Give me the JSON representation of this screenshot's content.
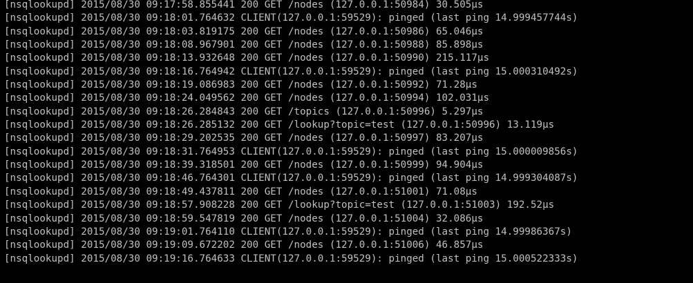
{
  "terminal": {
    "colors": {
      "background": "#000000",
      "foreground": "#c0c0c0"
    },
    "lines": [
      "[nsqlookupd] 2015/08/30 09:17:58.855441 200 GET /nodes (127.0.0.1:50984) 30.505µs",
      "[nsqlookupd] 2015/08/30 09:18:01.764632 CLIENT(127.0.0.1:59529): pinged (last ping 14.999457744s)",
      "[nsqlookupd] 2015/08/30 09:18:03.819175 200 GET /nodes (127.0.0.1:50986) 65.046µs",
      "[nsqlookupd] 2015/08/30 09:18:08.967901 200 GET /nodes (127.0.0.1:50988) 85.898µs",
      "[nsqlookupd] 2015/08/30 09:18:13.932648 200 GET /nodes (127.0.0.1:50990) 215.117µs",
      "[nsqlookupd] 2015/08/30 09:18:16.764942 CLIENT(127.0.0.1:59529): pinged (last ping 15.000310492s)",
      "[nsqlookupd] 2015/08/30 09:18:19.086983 200 GET /nodes (127.0.0.1:50992) 71.28µs",
      "[nsqlookupd] 2015/08/30 09:18:24.049562 200 GET /nodes (127.0.0.1:50994) 102.031µs",
      "[nsqlookupd] 2015/08/30 09:18:26.284843 200 GET /topics (127.0.0.1:50996) 5.297µs",
      "[nsqlookupd] 2015/08/30 09:18:26.285132 200 GET /lookup?topic=test (127.0.0.1:50996) 13.119µs",
      "[nsqlookupd] 2015/08/30 09:18:29.202535 200 GET /nodes (127.0.0.1:50997) 83.207µs",
      "[nsqlookupd] 2015/08/30 09:18:31.764953 CLIENT(127.0.0.1:59529): pinged (last ping 15.000009856s)",
      "[nsqlookupd] 2015/08/30 09:18:39.318501 200 GET /nodes (127.0.0.1:50999) 94.904µs",
      "[nsqlookupd] 2015/08/30 09:18:46.764301 CLIENT(127.0.0.1:59529): pinged (last ping 14.999304087s)",
      "[nsqlookupd] 2015/08/30 09:18:49.437811 200 GET /nodes (127.0.0.1:51001) 71.08µs",
      "[nsqlookupd] 2015/08/30 09:18:57.908228 200 GET /lookup?topic=test (127.0.0.1:51003) 192.52µs",
      "[nsqlookupd] 2015/08/30 09:18:59.547819 200 GET /nodes (127.0.0.1:51004) 32.086µs",
      "[nsqlookupd] 2015/08/30 09:19:01.764110 CLIENT(127.0.0.1:59529): pinged (last ping 14.99986367s)",
      "[nsqlookupd] 2015/08/30 09:19:09.672202 200 GET /nodes (127.0.0.1:51006) 46.857µs",
      "[nsqlookupd] 2015/08/30 09:19:16.764633 CLIENT(127.0.0.1:59529): pinged (last ping 15.000522333s)"
    ]
  }
}
